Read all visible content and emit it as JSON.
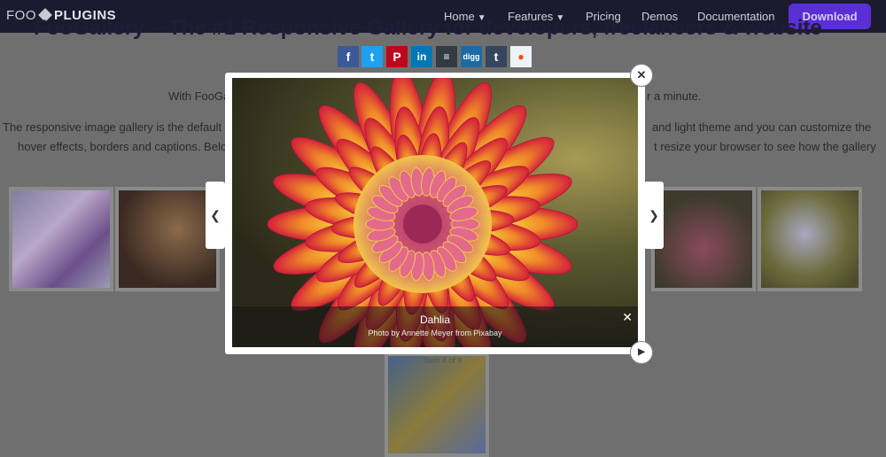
{
  "logo": {
    "foo": "FOO",
    "plugins": "PLUGINS"
  },
  "nav": {
    "home": "Home",
    "features": "Features",
    "pricing": "Pricing",
    "demos": "Demos",
    "documentation": "Documentation",
    "download": "Download"
  },
  "page": {
    "title": "FooGallery – The #1 Responsive Gallery for developers, freelancers & website",
    "line1_left": "With FooGa",
    "line1_right": "r a minute.",
    "line2_left": "The responsive image gallery is the default g",
    "line2_right": "and light theme and you can customize the",
    "line3_left": "hover effects, borders and captions. Below i",
    "line3_right": "t resize your browser to see how the gallery"
  },
  "share": [
    "f",
    "t",
    "p",
    "in",
    "buf",
    "digg",
    "t",
    "reddit"
  ],
  "lightbox": {
    "caption_title": "Dahlia",
    "caption_sub": "Photo by Annette Meyer from Pixabay",
    "counter": "Item 4 of 9"
  },
  "colors": {
    "nav_bg": "#1c1a2e",
    "download_bg": "#5b2fd6",
    "overlay": "#6f6f6f"
  }
}
